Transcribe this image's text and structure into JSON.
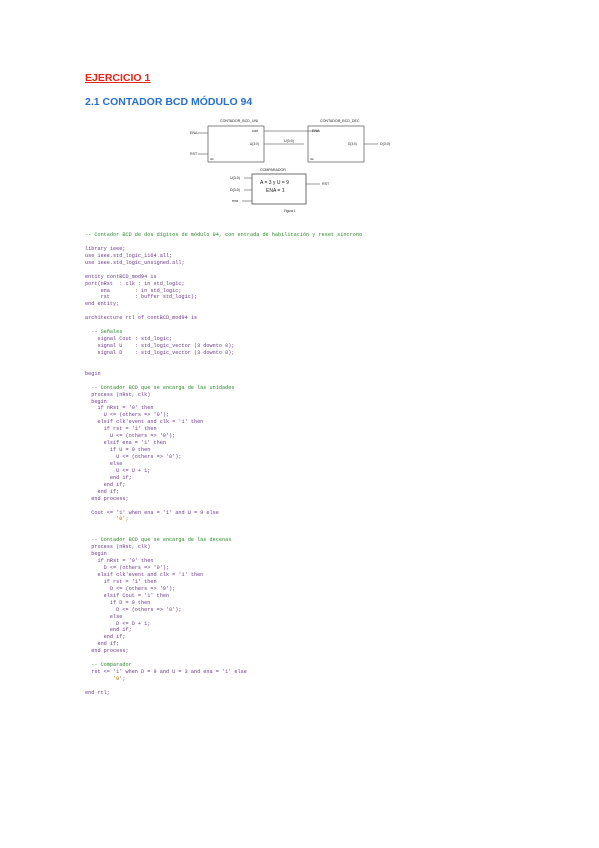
{
  "heading": "EJERCICIO 1",
  "subheading": "2.1 CONTADOR BCD MÓDULO 94",
  "diagram": {
    "block_u_title": "CONTADOR_BCD_UNI",
    "block_d_title": "CONTADOR_BCD_DEC",
    "comparator_title": "COMPARADOR",
    "in_ena": "ENA",
    "in_rst": "RST",
    "out_cout": "cout",
    "u_pin": "U(3:0)",
    "d_pin": "D(3:0)",
    "u_bus": "U(3:0)",
    "d_bus": "D(3:0)",
    "clk": "clk",
    "clk2": "clk",
    "bus_width": "4",
    "comp_u": "U(3:0)",
    "comp_d": "D(3:0)",
    "comp_ena": "ena",
    "comp_expr1": "A = 3 y U = 9",
    "comp_expr2": "ENA = 1",
    "comp_out": "RST",
    "ena_label": "ENA",
    "fig_caption": "Figura 1"
  },
  "code": [
    {
      "cls": "cm",
      "text": "-- Contador BCD de dos dígitos de módulo 94, con entrada de habilitación y reset síncrono"
    },
    {
      "cls": "",
      "text": ""
    },
    {
      "cls": "kw",
      "text": "library ieee;"
    },
    {
      "cls": "kw",
      "text": "use ieee.std_logic_1164.all;"
    },
    {
      "cls": "kw",
      "text": "use ieee.std_logic_unsigned.all;"
    },
    {
      "cls": "",
      "text": ""
    },
    {
      "cls": "kw",
      "text": "entity contBCD_mod94 is"
    },
    {
      "cls": "kw",
      "text": "port(nRst  : clk : in std_logic;"
    },
    {
      "cls": "kw",
      "text": "     ena        : in std_logic;"
    },
    {
      "cls": "kw",
      "text": "     rst        : buffer std_logic);"
    },
    {
      "cls": "kw",
      "text": "end entity;"
    },
    {
      "cls": "",
      "text": ""
    },
    {
      "cls": "kw",
      "text": "architecture rtl of contBCD_mod94 is"
    },
    {
      "cls": "",
      "text": ""
    },
    {
      "cls": "cm",
      "text": "  -- Señales"
    },
    {
      "cls": "kw",
      "text": "    signal Cout : std_logic;"
    },
    {
      "cls": "kw",
      "text": "    signal U    : std_logic_vector (3 downto 0);"
    },
    {
      "cls": "kw",
      "text": "    signal D    : std_logic_vector (3 downto 0);"
    },
    {
      "cls": "",
      "text": ""
    },
    {
      "cls": "",
      "text": ""
    },
    {
      "cls": "kw",
      "text": "begin"
    },
    {
      "cls": "",
      "text": ""
    },
    {
      "cls": "cm",
      "text": "  -- Contador BCD que se encarga de las unidades"
    },
    {
      "cls": "kw",
      "text": "  process (nRst, clk)"
    },
    {
      "cls": "kw",
      "text": "  begin"
    },
    {
      "cls": "kw",
      "text": "    if nRst = '0' then"
    },
    {
      "cls": "kw",
      "text": "      U <= (others => '0');"
    },
    {
      "cls": "kw",
      "text": "    elsif clk'event and clk = '1' then"
    },
    {
      "cls": "kw",
      "text": "      if rst = '1' then"
    },
    {
      "cls": "kw",
      "text": "        U <= (others => '0');"
    },
    {
      "cls": "kw",
      "text": "      elsif ena = '1' then"
    },
    {
      "cls": "kw",
      "text": "        if U = 9 then"
    },
    {
      "cls": "kw",
      "text": "          U <= (others => '0');"
    },
    {
      "cls": "kw",
      "text": "        else"
    },
    {
      "cls": "kw",
      "text": "          U <= U + 1;"
    },
    {
      "cls": "kw",
      "text": "        end if;"
    },
    {
      "cls": "kw",
      "text": "      end if;"
    },
    {
      "cls": "kw",
      "text": "    end if;"
    },
    {
      "cls": "kw",
      "text": "  end process;"
    },
    {
      "cls": "",
      "text": ""
    },
    {
      "cls": "kw",
      "text": "  Cout <= '1' when ena = '1' and U = 9 else"
    },
    {
      "cls": "st",
      "text": "          '0';"
    },
    {
      "cls": "",
      "text": ""
    },
    {
      "cls": "",
      "text": ""
    },
    {
      "cls": "cm",
      "text": "  -- Contador BCD que se encarga de las decenas"
    },
    {
      "cls": "kw",
      "text": "  process (nRst, clk)"
    },
    {
      "cls": "kw",
      "text": "  begin"
    },
    {
      "cls": "kw",
      "text": "    if nRst = '0' then"
    },
    {
      "cls": "kw",
      "text": "      D <= (others => '0');"
    },
    {
      "cls": "kw",
      "text": "    elsif clk'event and clk = '1' then"
    },
    {
      "cls": "kw",
      "text": "      if rst = '1' then"
    },
    {
      "cls": "kw",
      "text": "        D <= (others => '0');"
    },
    {
      "cls": "kw",
      "text": "      elsif Cout = '1' then"
    },
    {
      "cls": "kw",
      "text": "        if D = 9 then"
    },
    {
      "cls": "kw",
      "text": "          D <= (others => '0');"
    },
    {
      "cls": "kw",
      "text": "        else"
    },
    {
      "cls": "kw",
      "text": "          D <= D + 1;"
    },
    {
      "cls": "kw",
      "text": "        end if;"
    },
    {
      "cls": "kw",
      "text": "      end if;"
    },
    {
      "cls": "kw",
      "text": "    end if;"
    },
    {
      "cls": "kw",
      "text": "  end process;"
    },
    {
      "cls": "",
      "text": ""
    },
    {
      "cls": "cm",
      "text": "  -- Comparador"
    },
    {
      "cls": "kw",
      "text": "  rst <= '1' when D = 9 and U = 3 and ena = '1' else"
    },
    {
      "cls": "st",
      "text": "         '0';"
    },
    {
      "cls": "",
      "text": ""
    },
    {
      "cls": "kw",
      "text": "end rtl;"
    }
  ]
}
